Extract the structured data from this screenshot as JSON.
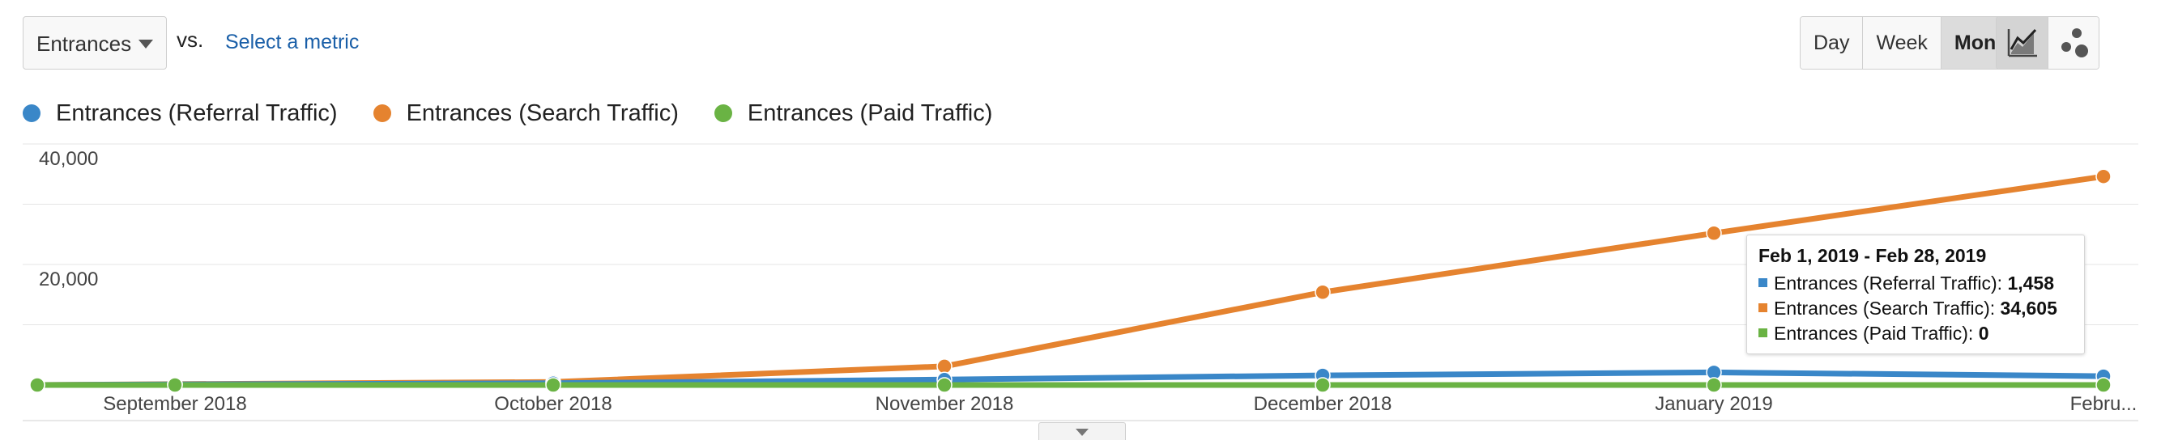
{
  "toolbar": {
    "metric_select_value": "Entrances",
    "vs_label": "vs.",
    "select_metric_link": "Select a metric",
    "period_buttons": [
      "Day",
      "Week",
      "Month"
    ],
    "active_period": "Month",
    "view_icons": [
      "line-chart-icon",
      "motion-chart-icon"
    ]
  },
  "tooltip": {
    "title": "Feb 1, 2019 - Feb 28, 2019",
    "rows": [
      {
        "label": "Entrances (Referral Traffic):",
        "value": "1,458"
      },
      {
        "label": "Entrances (Search Traffic):",
        "value": "34,605"
      },
      {
        "label": "Entrances (Paid Traffic):",
        "value": "0"
      }
    ]
  },
  "chart_data": {
    "type": "line",
    "x": [
      "",
      "September 2018",
      "October 2018",
      "November 2018",
      "December 2018",
      "January 2019",
      "Febru..."
    ],
    "series": [
      {
        "name": "Entrances (Referral Traffic)",
        "color": "#3a87c8",
        "values": [
          0,
          100,
          300,
          900,
          1600,
          2100,
          1458
        ]
      },
      {
        "name": "Entrances (Search Traffic)",
        "color": "#e5832f",
        "values": [
          0,
          150,
          500,
          3100,
          15400,
          25200,
          34605
        ]
      },
      {
        "name": "Entrances (Paid Traffic)",
        "color": "#6ab344",
        "values": [
          0,
          0,
          0,
          0,
          0,
          0,
          0
        ]
      }
    ],
    "yticks": [
      {
        "value": 20000,
        "label": "20,000"
      },
      {
        "value": 40000,
        "label": "40,000"
      }
    ],
    "ylim": [
      0,
      40000
    ],
    "grid": true,
    "legend_position": "top-left"
  }
}
